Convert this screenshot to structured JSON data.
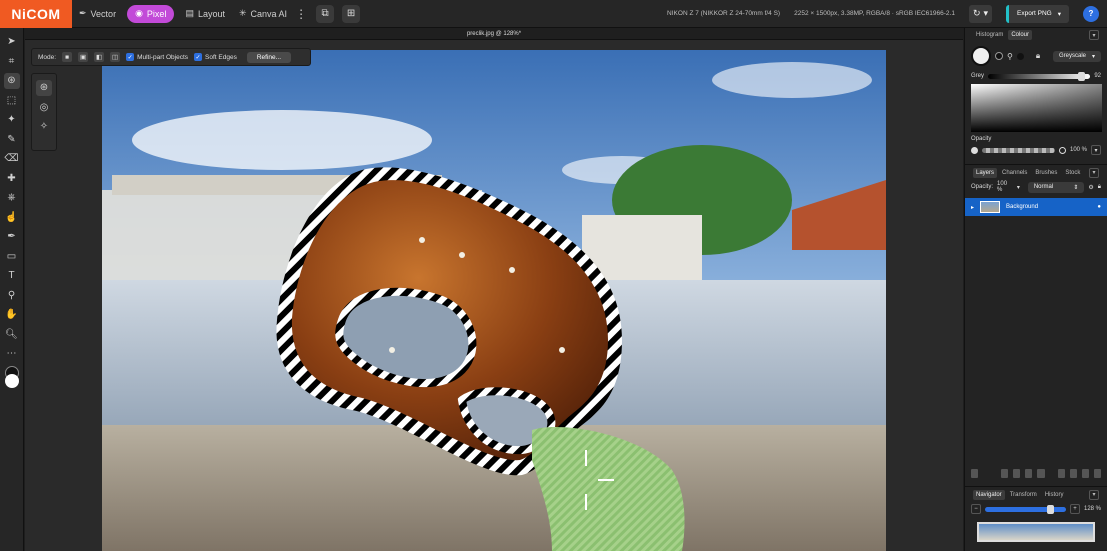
{
  "app": {
    "logo": "NiCOM",
    "personas": [
      {
        "label": "Vector",
        "icon": "pen-nib-icon"
      },
      {
        "label": "Pixel",
        "icon": "pixel-brush-icon",
        "active": true
      },
      {
        "label": "Layout",
        "icon": "layout-icon"
      },
      {
        "label": "Canva AI",
        "icon": "sparkle-icon"
      }
    ],
    "camera": "NIKON Z 7 (NIKKOR Z 24-70mm f/4 S)",
    "dimensions": "2252 × 1500px, 3.38MP, RGBA/8 · sRGB IEC61966-2.1",
    "export_label": "Export PNG",
    "help": "?",
    "accent": "#c24ad8"
  },
  "document": {
    "title": "preclik.jpg @ 128%*"
  },
  "context_toolbar": {
    "mode_label": "Mode:",
    "multipart_label": "Multi-part Objects",
    "soft_edges_label": "Soft Edges",
    "refine_label": "Refine..."
  },
  "right_panel": {
    "color_tabs": [
      "Histogram",
      "Colour"
    ],
    "color_mode": "Greyscale",
    "grey_label": "Grey",
    "grey_value": "92",
    "grey_fraction": 0.92,
    "opacity_label": "Opacity",
    "opacity_value": "100 %",
    "layer_tabs": [
      "Layers",
      "Channels",
      "Brushes",
      "Stock"
    ],
    "layer_opacity_label": "Opacity:",
    "layer_opacity_value": "100 %",
    "blend_mode": "Normal",
    "layers": [
      {
        "name": "Background"
      }
    ],
    "nav_tabs": [
      "Navigator",
      "Transform",
      "History"
    ],
    "zoom_value": "128 %",
    "zoom_fraction": 0.82
  }
}
